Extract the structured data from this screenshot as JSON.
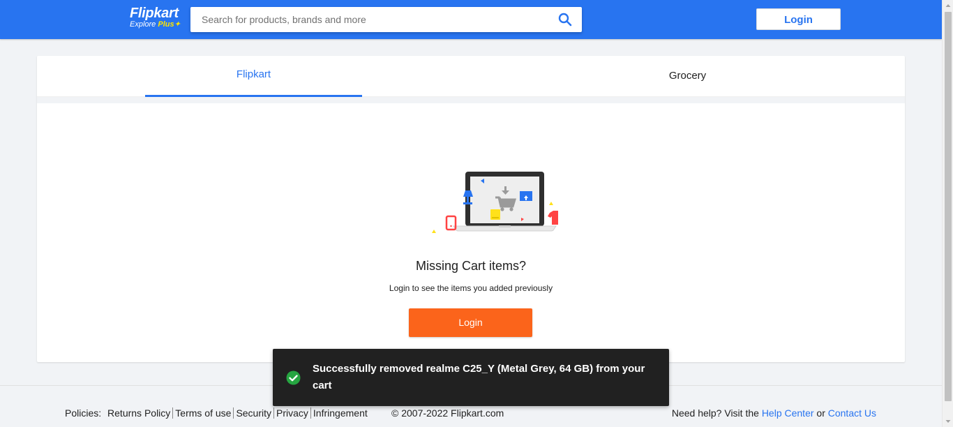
{
  "header": {
    "brand": "Flipkart",
    "tagline_prefix": "Explore ",
    "tagline_plus": "Plus",
    "search_placeholder": "Search for products, brands and more",
    "search_value": "",
    "login_label": "Login"
  },
  "tabs": [
    {
      "label": "Flipkart",
      "active": true
    },
    {
      "label": "Grocery",
      "active": false
    }
  ],
  "empty_state": {
    "title": "Missing Cart items?",
    "subtitle": "Login to see the items you added previously",
    "login_label": "Login"
  },
  "footer": {
    "policies_label": "Policies:",
    "policy_links": [
      "Returns Policy",
      "Terms of use",
      "Security",
      "Privacy",
      "Infringement"
    ],
    "copyright": "© 2007-2022 Flipkart.com",
    "help_prefix": "Need help? Visit the ",
    "help_center": "Help Center",
    "help_or": " or ",
    "contact_us": "Contact Us"
  },
  "toast": {
    "message": "Successfully removed realme C25_Y (Metal Grey, 64 GB) from your cart",
    "icon": "check-circle-icon"
  },
  "colors": {
    "brand_blue": "#2874f0",
    "cta_orange": "#fb641b",
    "toast_bg": "#212121",
    "success_green": "#26a541",
    "accent_yellow": "#ffe500"
  }
}
